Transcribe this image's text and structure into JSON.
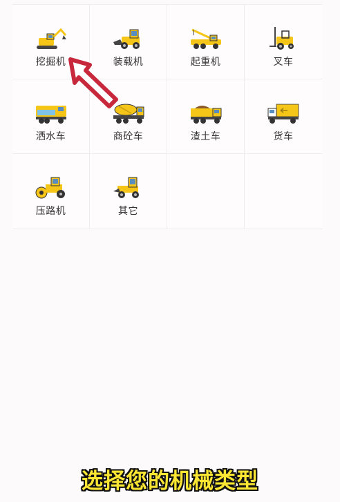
{
  "machines": [
    {
      "label": "挖掘机",
      "icon": "excavator-icon"
    },
    {
      "label": "装载机",
      "icon": "loader-icon"
    },
    {
      "label": "起重机",
      "icon": "crane-icon"
    },
    {
      "label": "叉车",
      "icon": "forklift-icon"
    },
    {
      "label": "洒水车",
      "icon": "sprinkler-truck-icon"
    },
    {
      "label": "商砼车",
      "icon": "concrete-mixer-icon"
    },
    {
      "label": "渣土车",
      "icon": "dump-truck-icon"
    },
    {
      "label": "货车",
      "icon": "cargo-truck-icon"
    },
    {
      "label": "压路机",
      "icon": "road-roller-icon"
    },
    {
      "label": "其它",
      "icon": "other-machine-icon"
    }
  ],
  "caption": "选择您的机械类型",
  "colors": {
    "machine_yellow": "#f5c518",
    "cursor": "#c8283c",
    "caption_text": "#fbe733",
    "caption_outline": "#111111"
  }
}
